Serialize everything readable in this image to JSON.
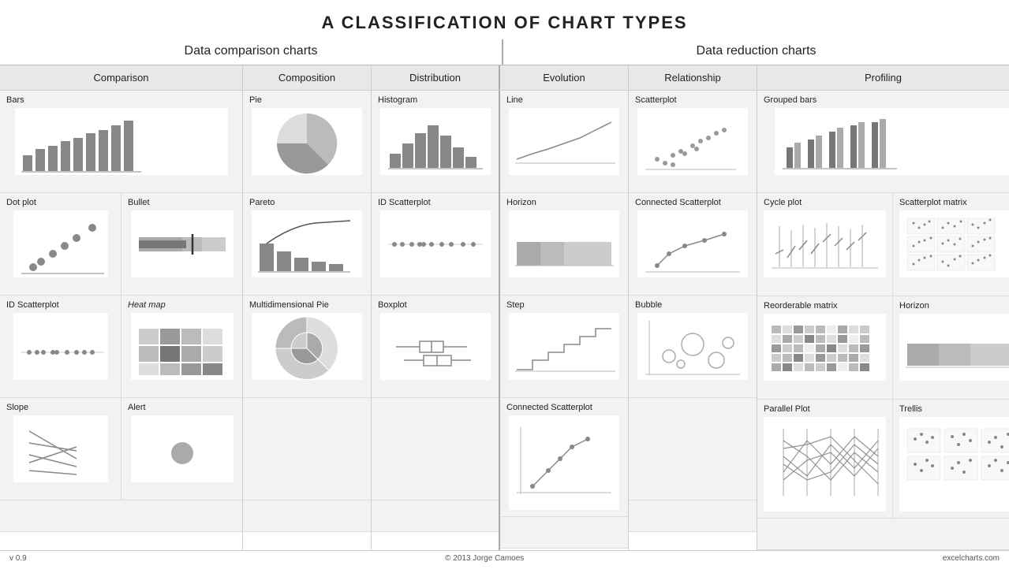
{
  "title": "A CLASSIFICATION OF CHART TYPES",
  "section_left": "Data comparison charts",
  "section_right": "Data reduction charts",
  "categories": {
    "comparison": "Comparison",
    "composition": "Composition",
    "distribution": "Distribution",
    "evolution": "Evolution",
    "relationship": "Relationship",
    "profiling": "Profiling"
  },
  "charts": {
    "bars": "Bars",
    "dot_plot": "Dot plot",
    "bullet": "Bullet",
    "id_scatterplot_1": "ID Scatterplot",
    "heatmap": "Heat map",
    "slope": "Slope",
    "alert": "Alert",
    "pie": "Pie",
    "pareto": "Pareto",
    "multidimensional_pie": "Multidimensional Pie",
    "histogram": "Histogram",
    "id_scatterplot_2": "ID Scatterplot",
    "boxplot": "Boxplot",
    "line": "Line",
    "horizon": "Horizon",
    "step": "Step",
    "connected_scatterplot_2": "Connected Scatterplot",
    "scatterplot": "Scatterplot",
    "connected_scatterplot": "Connected Scatterplot",
    "bubble": "Bubble",
    "grouped_bars": "Grouped bars",
    "cycle_plot": "Cycle plot",
    "scatterplot_matrix": "Scatterplot matrix",
    "reorderable_matrix": "Reorderable matrix",
    "horizon_profiling": "Horizon",
    "parallel_plot": "Parallel Plot",
    "trellis": "Trellis"
  },
  "footer": {
    "version": "v 0.9",
    "author": "© 2013 Jorge Camoes",
    "website": "excelcharts.com"
  }
}
